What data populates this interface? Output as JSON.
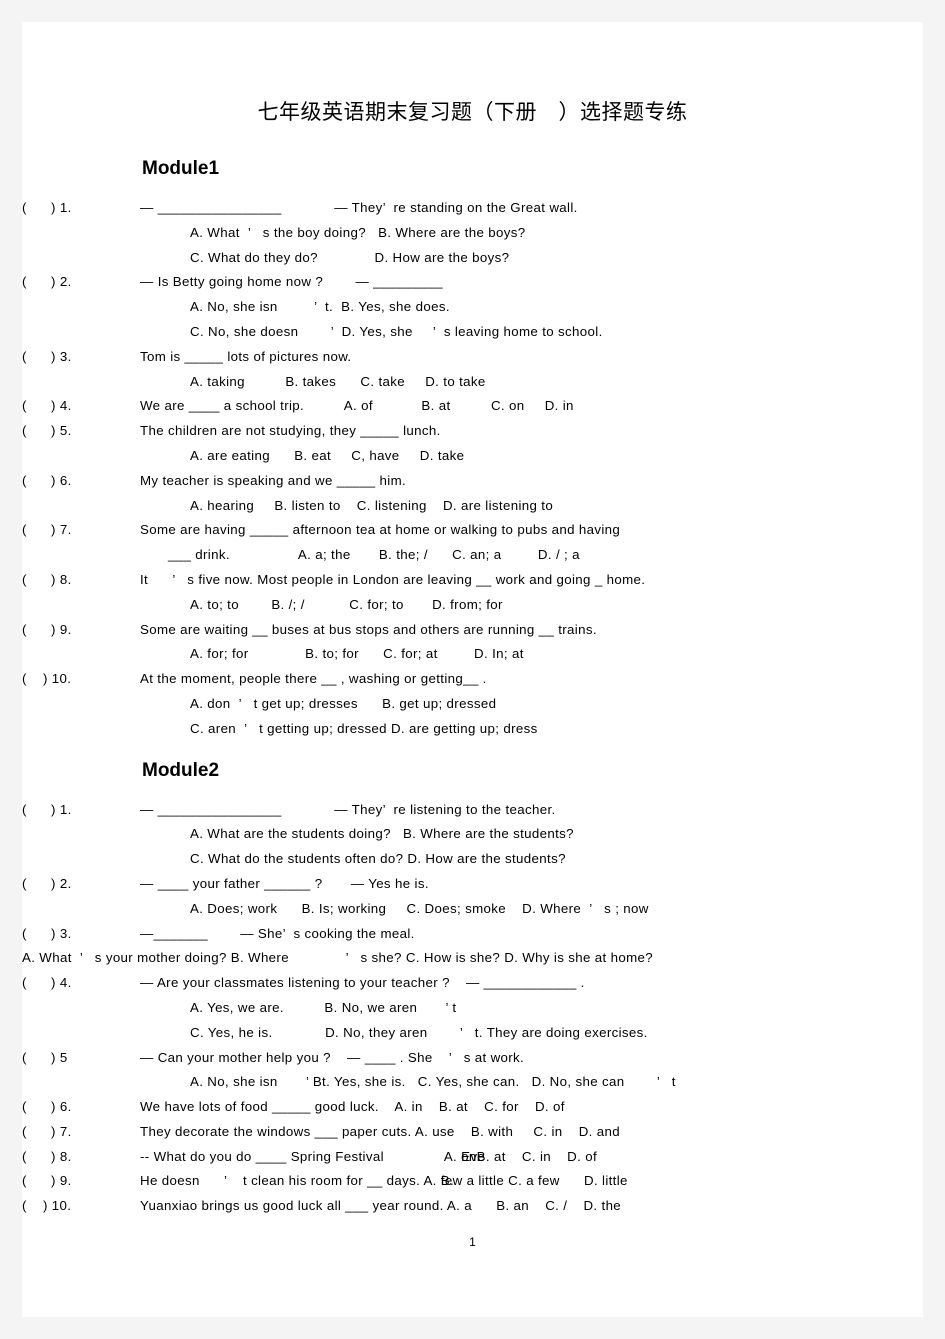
{
  "document": {
    "title": "七年级英语期末复习题（下册   ）选择题专练",
    "page_number": "1"
  },
  "modules": [
    {
      "heading": "Module1",
      "questions": [
        {
          "marker": "(      ) 1.",
          "stem": "— ________________             — They’  re standing on the Great wall.",
          "lines": [
            "A. What  ’   s the boy doing?   B. Where are the boys?",
            "C. What do they do?              D. How are the boys?"
          ]
        },
        {
          "marker": "(      ) 2.",
          "stem": "— Is Betty going home now ?        — _________",
          "lines": [
            "A. No, she isn         ’  t.  B. Yes, she does.",
            "C. No, she doesn        ’  D. Yes, she     ’  s leaving home to school."
          ]
        },
        {
          "marker": "(      ) 3.",
          "stem": "Tom is _____ lots of pictures now.",
          "lines": [
            "A. taking          B. takes      C. take     D. to take"
          ]
        },
        {
          "marker": "(      ) 4.",
          "stem": "We are ____ a school trip.          A. of            B. at          C. on     D. in",
          "lines": []
        },
        {
          "marker": "(      ) 5.",
          "stem": "The children are not studying, they _____ lunch.",
          "lines": [
            "A. are eating      B. eat     C, have     D. take"
          ]
        },
        {
          "marker": "(      ) 6.",
          "stem": "My teacher is speaking and we _____ him.",
          "lines": [
            "A. hearing     B. listen to    C. listening    D. are listening to"
          ]
        },
        {
          "marker": "(      ) 7.",
          "stem": "Some are having _____ afternoon tea at home or walking to pubs and having",
          "cont": "___ drink.                 A. a; the       B. the; /      C. an; a         D. / ; a",
          "lines": []
        },
        {
          "marker": "(      ) 8.",
          "stem": "It      ’   s five now. Most people in London are leaving __ work and going _ home.",
          "lines": [
            "A. to; to        B. /; /           C. for; to       D. from; for"
          ]
        },
        {
          "marker": "(      ) 9.",
          "stem": "Some are waiting __ buses at bus stops and others are running __ trains.",
          "lines": [
            "A. for; for              B. to; for      C. for; at         D. In; at"
          ]
        },
        {
          "marker": "(    ) 10.",
          "stem": "At the moment, people there __ , washing or getting__ .",
          "lines": [
            "A. don  ’   t get up; dresses      B. get up; dressed",
            "C. aren  ’   t getting up; dressed D. are getting up; dress"
          ]
        }
      ]
    },
    {
      "heading": "Module2",
      "questions": [
        {
          "marker": "(      ) 1.",
          "stem": "— ________________             — They’  re listening to the teacher.",
          "lines": [
            "A. What are the students doing?   B. Where are the students?",
            "C. What do the students often do? D. How are the students?"
          ]
        },
        {
          "marker": "(      ) 2.",
          "stem": "— ____ your father ______ ?       — Yes he is.",
          "lines": [
            "A. Does; work      B. Is; working     C. Does; smoke    D. Where  ’   s ; now"
          ]
        },
        {
          "marker": "(      ) 3.",
          "stem": "—_______        — She’  s cooking the meal.",
          "flush_line": "A. What  ’   s your mother doing? B. Where              ’   s she? C. How is she? D. Why is she at home?",
          "lines": []
        },
        {
          "marker": "(      ) 4.",
          "stem": "— Are your classmates listening to your teacher ?    — ____________ .",
          "lines": [
            "A. Yes, we are.          B. No, we aren       ’ t",
            "C. Yes, he is.             D. No, they aren        ’   t. They are doing exercises."
          ]
        },
        {
          "marker": "(      ) 5",
          "stem": "— Can your mother help you ?    — ____ . She    ’   s at work.",
          "lines": [
            "A. No, she isn       ’ Bt. Yes, she is.   C. Yes, she can.   D. No, she can        ’   t"
          ]
        },
        {
          "marker": "(      ) 6.",
          "stem": "We have lots of food _____ good luck.    A. in    B. at    C. for    D. of",
          "lines": []
        },
        {
          "marker": "(      ) 7.",
          "stem": "They decorate the windows ___ paper cuts. A. use    B. with     C. in    D. and",
          "lines": []
        },
        {
          "marker": "(      ) 8.",
          "stem_pre": "-- What do you do ____ Spring Festival               A. ",
          "overlap_base": "on",
          "overlap_over": "Eve",
          "stem_post": "B. at    C. in    D. of",
          "lines": []
        },
        {
          "marker": "(      ) 9.",
          "stem_pre": "He doesn      ’    t clean his room for __ days. A. ",
          "overlap_base": "few",
          "overlap_over": "B.",
          "stem_post": " a little C. a few      D. little",
          "lines": []
        },
        {
          "marker": "(    ) 10.",
          "stem": "Yuanxiao brings us good luck all ___ year round. A. a      B. an    C. /    D. the",
          "lines": []
        }
      ]
    }
  ]
}
